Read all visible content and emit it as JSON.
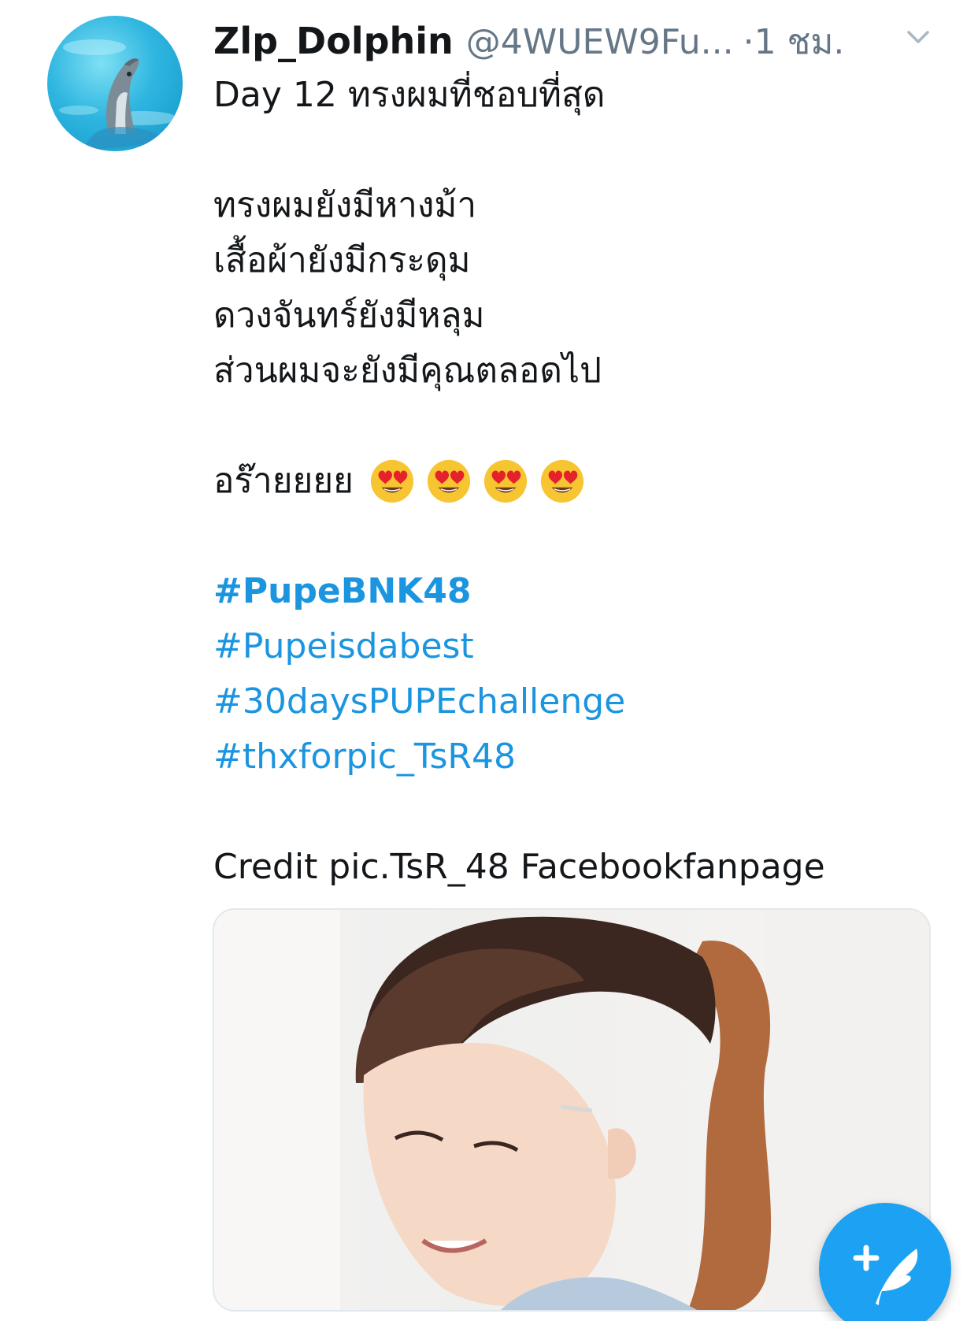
{
  "tweet": {
    "display_name": "Zlp_Dolphin",
    "handle": "@4WUEW9Fu...",
    "separator": "·",
    "time": "1 ชม.",
    "lines": [
      "Day 12 ทรงผมที่ชอบที่สุด",
      "ทรงผมยังมีหางม้า",
      "เสื้อผ้ายังมีกระดุม",
      "ดวงจันทร์ยังมีหลุม",
      "ส่วนผมจะยังมีคุณตลอดไป",
      "อร๊ายยยย"
    ],
    "hashtags": [
      "#PupeBNK48",
      "#Pupeisdabest",
      "#30daysPUPEchallenge",
      "#thxforpic_TsR48"
    ],
    "credit": "Credit pic.TsR_48 Facebookfanpage"
  },
  "icons": {
    "avatar": "dolphin-avatar",
    "menu": "chevron-down-icon",
    "emoji": "heart-eyes-emoji",
    "compose": "compose-tweet-icon"
  },
  "colors": {
    "link": "#1b95e0",
    "secondary_text": "#657786",
    "fab": "#1da1f2"
  }
}
